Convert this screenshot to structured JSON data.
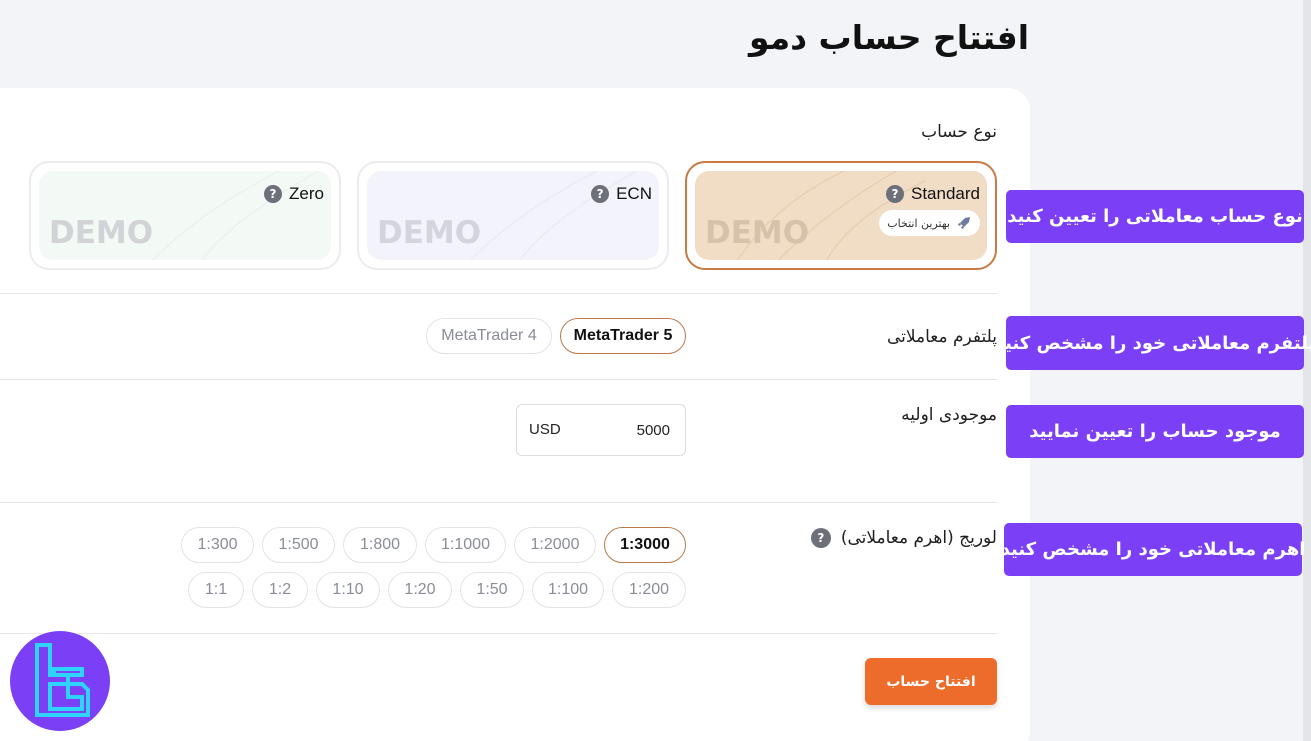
{
  "page": {
    "title": "افتتاح حساب دمو"
  },
  "account_type": {
    "label": "نوع حساب",
    "cards": [
      {
        "name": "Standard",
        "badge": "بهترین انتخاب",
        "watermark": "DEMO",
        "selected": true,
        "tint": "#f1dcc6"
      },
      {
        "name": "ECN",
        "watermark": "DEMO",
        "selected": false,
        "tint": "#f3f3fc"
      },
      {
        "name": "Zero",
        "watermark": "DEMO",
        "selected": false,
        "tint": "#f3f9f5"
      }
    ]
  },
  "platform": {
    "label": "پلتفرم معاملاتی",
    "options": [
      {
        "label": "MetaTrader 5",
        "selected": true
      },
      {
        "label": "MetaTrader 4",
        "selected": false
      }
    ]
  },
  "balance": {
    "label": "موجودی اولیه",
    "value": "5000",
    "currency": "USD"
  },
  "leverage": {
    "label": "لوریج (اهرم معاملاتی)",
    "row1": [
      "1:3000",
      "1:2000",
      "1:1000",
      "1:800",
      "1:500",
      "1:300"
    ],
    "row2": [
      "1:200",
      "1:100",
      "1:50",
      "1:20",
      "1:10",
      "1:2",
      "1:1"
    ],
    "selected": "1:3000"
  },
  "submit": {
    "label": "افتتاح حساب"
  },
  "callouts": {
    "account_type": "نوع حساب معاملاتی را تعیین کنید",
    "platform": "پلتفرم معاملاتی خود را مشخص کنید",
    "balance": "موجود حساب را تعیین نمایید",
    "leverage": "اهرم معاملاتی خود را مشخص کنید"
  },
  "colors": {
    "accent": "#ee6c2b",
    "selected_border": "#c97a45",
    "callout_bg": "#7b3ff5"
  }
}
